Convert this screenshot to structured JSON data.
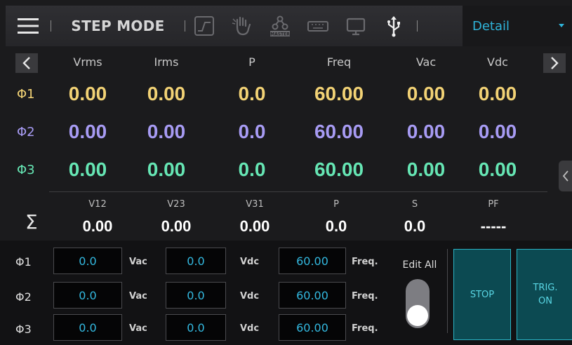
{
  "header": {
    "mode_title": "STEP MODE",
    "view_select": {
      "selected": "Detail"
    },
    "icons": [
      "menu-icon",
      "waveform-icon",
      "hand-icon",
      "master-icon",
      "keyboard-icon",
      "monitor-icon",
      "usb-icon"
    ],
    "master_icon_text": "MASTER"
  },
  "measurements": {
    "columns": [
      "Vrms",
      "Irms",
      "P",
      "Freq",
      "Vac",
      "Vdc"
    ],
    "rows": [
      {
        "label": "Φ1",
        "values": [
          "0.00",
          "0.00",
          "0.0",
          "60.00",
          "0.00",
          "0.00"
        ]
      },
      {
        "label": "Φ2",
        "values": [
          "0.00",
          "0.00",
          "0.0",
          "60.00",
          "0.00",
          "0.00"
        ]
      },
      {
        "label": "Φ3",
        "values": [
          "0.00",
          "0.00",
          "0.0",
          "60.00",
          "0.00",
          "0.00"
        ]
      }
    ],
    "phase_colors": [
      "#f2d275",
      "#a79bf3",
      "#66e6b4"
    ]
  },
  "summary": {
    "symbol": "Σ",
    "columns": [
      "V12",
      "V23",
      "V31",
      "P",
      "S",
      "PF"
    ],
    "values": [
      "0.00",
      "0.00",
      "0.00",
      "0.0",
      "0.0",
      "-----"
    ]
  },
  "edit_panel": {
    "rows": [
      {
        "label": "Φ1",
        "vac": "0.0",
        "vdc": "0.0",
        "freq": "60.00"
      },
      {
        "label": "Φ2",
        "vac": "0.0",
        "vdc": "0.0",
        "freq": "60.00"
      },
      {
        "label": "Φ3",
        "vac": "0.0",
        "vdc": "0.0",
        "freq": "60.00"
      }
    ],
    "units": {
      "vac": "Vac",
      "vdc": "Vdc",
      "freq": "Freq."
    },
    "edit_all_label": "Edit All",
    "edit_all_on": false,
    "stop_label": "STOP",
    "trig_label_line1": "TRIG.",
    "trig_label_line2": "ON"
  },
  "colors": {
    "accent": "#2fb3d9",
    "button_fill": "#0c4a52",
    "button_border": "#2ab3c4"
  }
}
